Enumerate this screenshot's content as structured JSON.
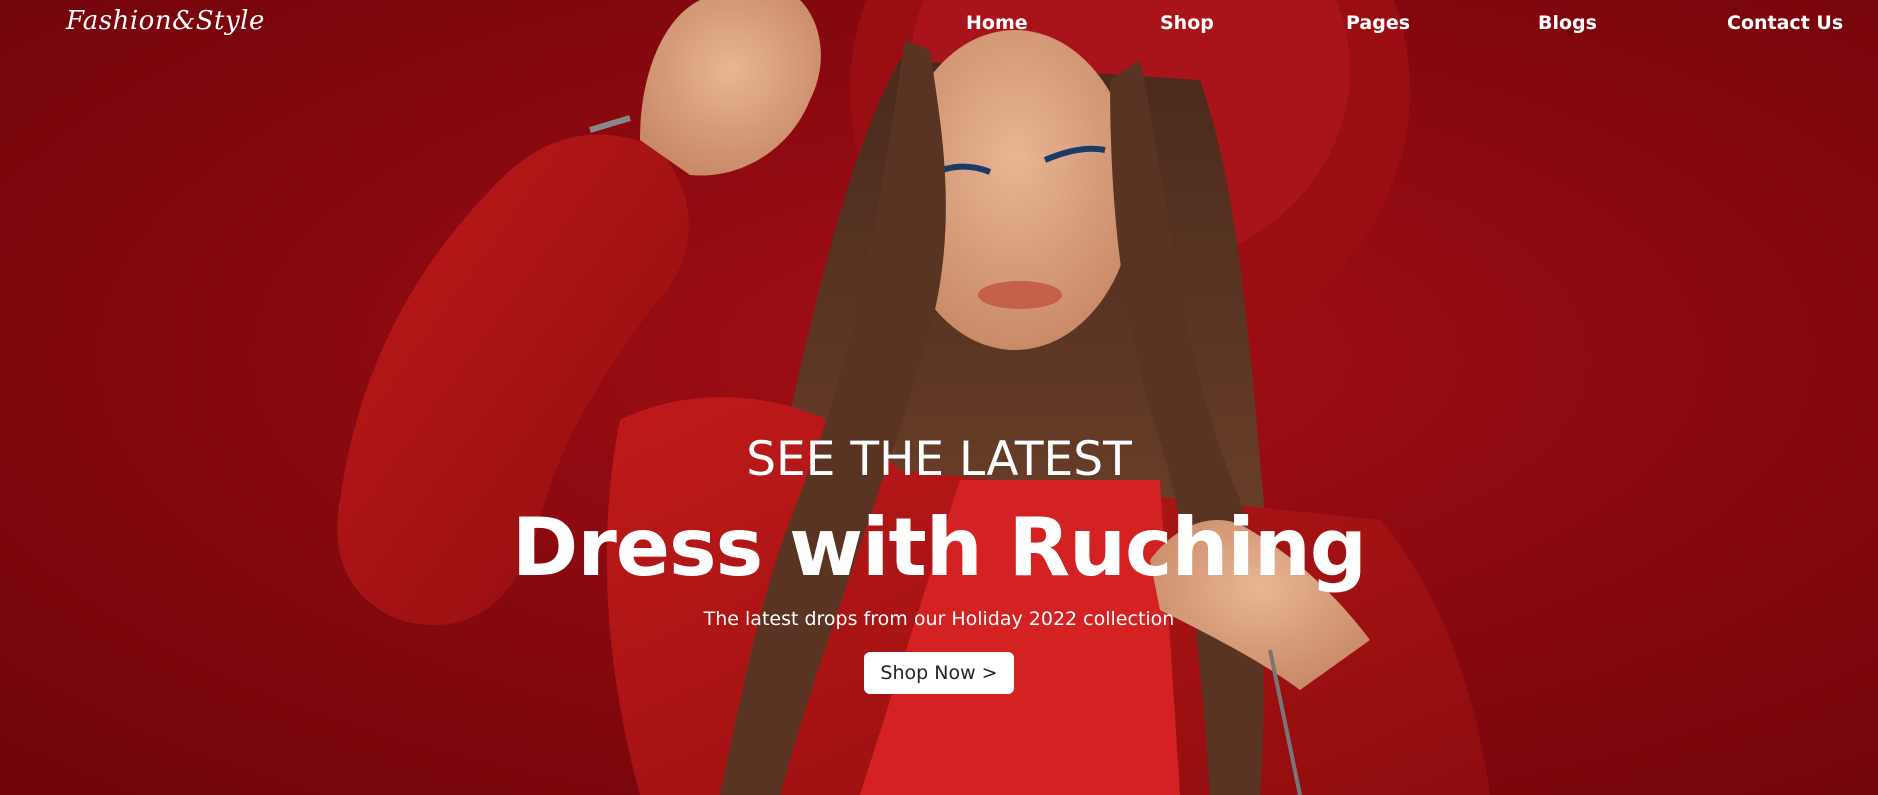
{
  "brand": {
    "logo_text": "Fashion&Style"
  },
  "nav": {
    "items": [
      {
        "label": "Home"
      },
      {
        "label": "Shop"
      },
      {
        "label": "Pages"
      },
      {
        "label": "Blogs"
      },
      {
        "label": "Contact Us"
      }
    ]
  },
  "hero": {
    "eyebrow": "SEE THE LATEST",
    "headline": "Dress with Ruching",
    "subtitle": "The latest drops from our Holiday 2022 collection",
    "cta_label": "Shop Now >",
    "image": "hero-photo"
  },
  "colors": {
    "background": "#8b0910",
    "text": "#ffffff",
    "button_bg": "#ffffff",
    "button_text": "#222222"
  }
}
